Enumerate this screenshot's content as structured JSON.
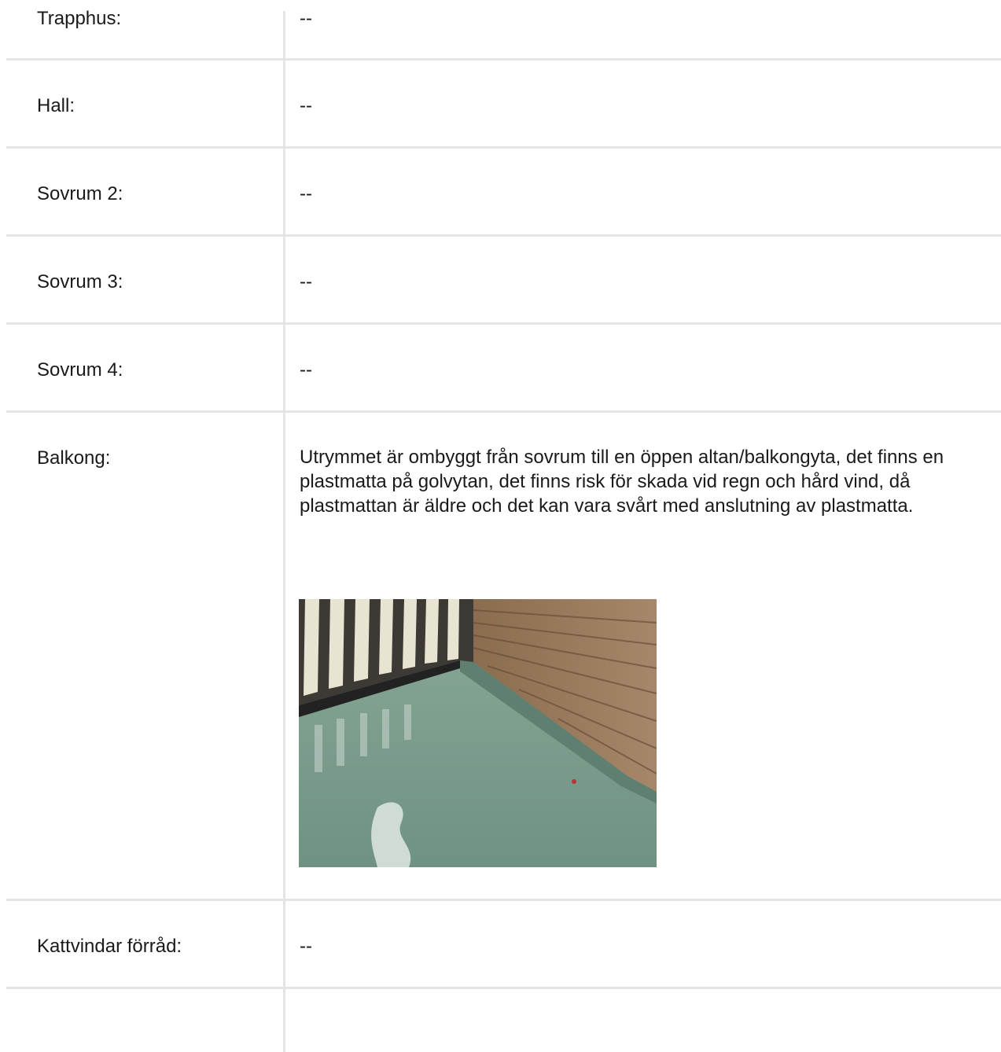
{
  "rows": [
    {
      "label": "Trapphus:",
      "value": "--"
    },
    {
      "label": "Hall:",
      "value": "--"
    },
    {
      "label": "Sovrum 2:",
      "value": "--"
    },
    {
      "label": "Sovrum 3:",
      "value": "--"
    },
    {
      "label": "Sovrum 4:",
      "value": "--"
    },
    {
      "label": "Balkong:",
      "value": "Utrymmet är ombyggt från sovrum till en öppen altan/balkongyta, det finns en plastmatta på golvytan, det finns risk för skada vid regn och hård vind, då plastmattan är äldre och det kan vara svårt med anslutning av plastmatta."
    },
    {
      "label": "Kattvindar förråd:",
      "value": "--"
    }
  ],
  "colors": {
    "divider": "#e4e4e4",
    "text": "#1a1a1a",
    "floor": "#7a9a8a",
    "wood": "#9a7a5a"
  }
}
